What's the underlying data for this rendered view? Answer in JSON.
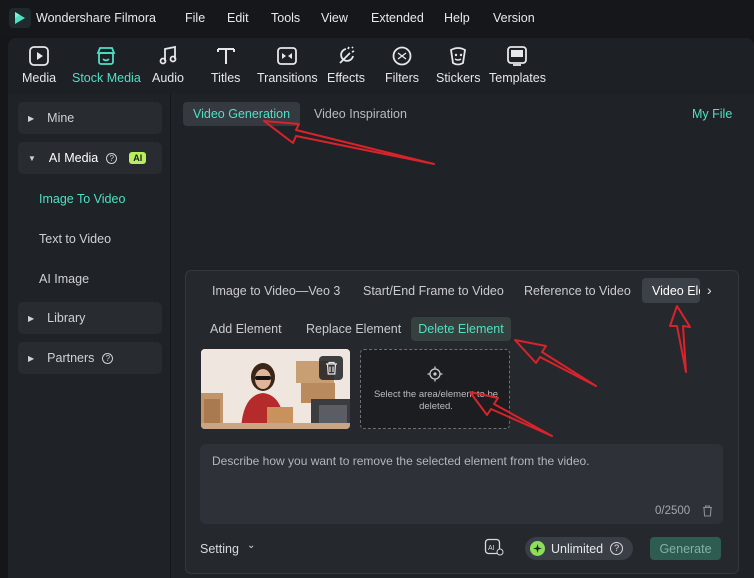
{
  "app": {
    "title": "Wondershare Filmora",
    "logo_icon": "filmora-logo-icon"
  },
  "menu": [
    "File",
    "Edit",
    "Tools",
    "View",
    "Extended",
    "Help",
    "Version"
  ],
  "toolbar": {
    "items": [
      {
        "label": "Media",
        "icon": "media-icon"
      },
      {
        "label": "Stock Media",
        "icon": "stock-media-icon",
        "active": true
      },
      {
        "label": "Audio",
        "icon": "audio-icon"
      },
      {
        "label": "Titles",
        "icon": "titles-icon"
      },
      {
        "label": "Transitions",
        "icon": "transitions-icon"
      },
      {
        "label": "Effects",
        "icon": "effects-icon"
      },
      {
        "label": "Filters",
        "icon": "filters-icon"
      },
      {
        "label": "Stickers",
        "icon": "stickers-icon"
      },
      {
        "label": "Templates",
        "icon": "templates-icon"
      }
    ]
  },
  "sidebar": {
    "mine": "Mine",
    "ai_media": "AI Media",
    "ai_badge": "AI",
    "sub_items": [
      "Image To Video",
      "Text to Video",
      "AI Image"
    ],
    "library": "Library",
    "partners": "Partners"
  },
  "top_tabs": {
    "video_generation": "Video Generation",
    "video_inspiration": "Video Inspiration",
    "my_file": "My File"
  },
  "panel": {
    "tabs": [
      "Image to Video—Veo 3",
      "Start/End Frame to Video",
      "Reference to Video",
      "Video Ele"
    ],
    "sub_tabs": [
      "Add Element",
      "Replace Element",
      "Delete Element"
    ],
    "dropzone_text": "Select the area/element to be deleted.",
    "prompt_placeholder": "Describe how you want to remove the selected element from the video.",
    "counter": "0/2500",
    "setting": "Setting",
    "unlimited": "Unlimited",
    "generate": "Generate"
  },
  "colors": {
    "accent": "#4fe0c4",
    "annotation_arrow": "#d9232a",
    "ai_badge": "#b7f05c"
  }
}
